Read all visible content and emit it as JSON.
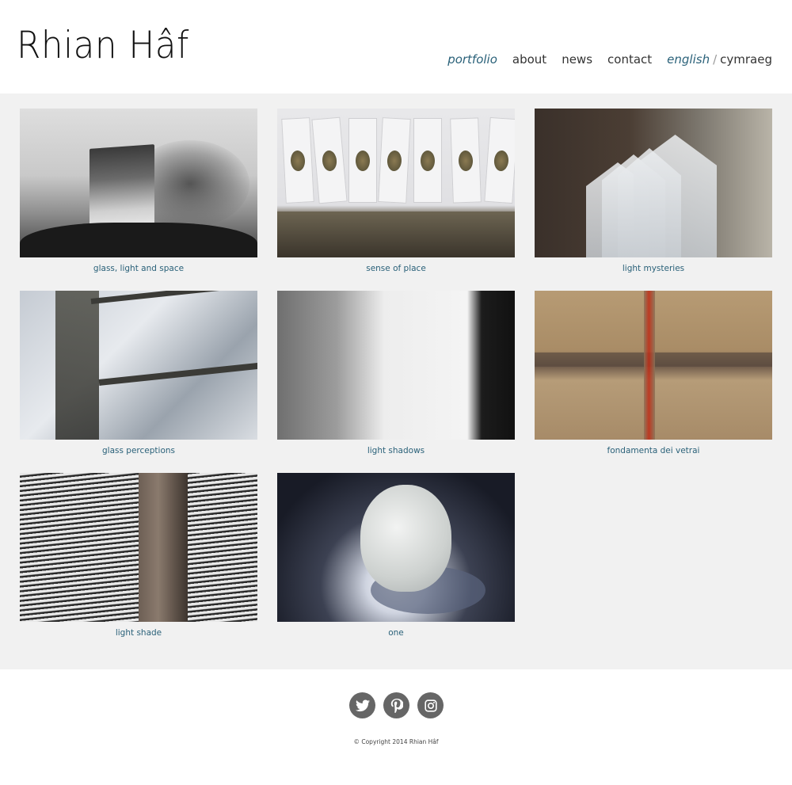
{
  "site": {
    "title": "Rhian Hâf"
  },
  "nav": {
    "portfolio": "portfolio",
    "about": "about",
    "news": "news",
    "contact": "contact",
    "lang_en": "english",
    "lang_sep": "/",
    "lang_cy": "cymraeg"
  },
  "gallery": [
    {
      "caption": "glass, light and space"
    },
    {
      "caption": "sense of place"
    },
    {
      "caption": "light mysteries"
    },
    {
      "caption": "glass perceptions"
    },
    {
      "caption": "light shadows"
    },
    {
      "caption": "fondamenta dei vetrai"
    },
    {
      "caption": "light shade"
    },
    {
      "caption": "one"
    }
  ],
  "footer": {
    "social": [
      {
        "icon": "twitter-icon"
      },
      {
        "icon": "pinterest-icon"
      },
      {
        "icon": "instagram-icon"
      }
    ],
    "copyright": "© Copyright 2014 Rhian Hâf"
  },
  "colors": {
    "accent": "#2a6179",
    "gallery_bg": "#f1f1f1",
    "icon_bg": "#666666"
  }
}
